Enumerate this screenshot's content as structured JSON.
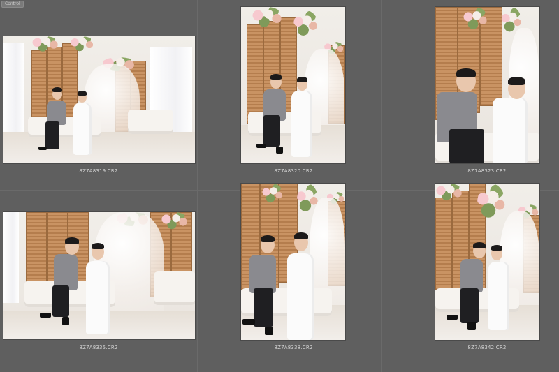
{
  "window": {
    "tab_label": "Control"
  },
  "grid": {
    "thumbnails": [
      {
        "filename": "8Z7A8319.CR2",
        "orientation": "landscape"
      },
      {
        "filename": "8Z7A8320.CR2",
        "orientation": "portrait"
      },
      {
        "filename": "8Z7A8323.CR2",
        "orientation": "portrait"
      },
      {
        "filename": "8Z7A8335.CR2",
        "orientation": "landscape"
      },
      {
        "filename": "8Z7A8338.CR2",
        "orientation": "portrait"
      },
      {
        "filename": "8Z7A8342.CR2",
        "orientation": "portrait"
      }
    ]
  },
  "colors": {
    "background": "#5f5f5f",
    "caption_text": "#d6d6d6",
    "wood_panel": "#c99363",
    "suit": "#8a8a8f"
  }
}
